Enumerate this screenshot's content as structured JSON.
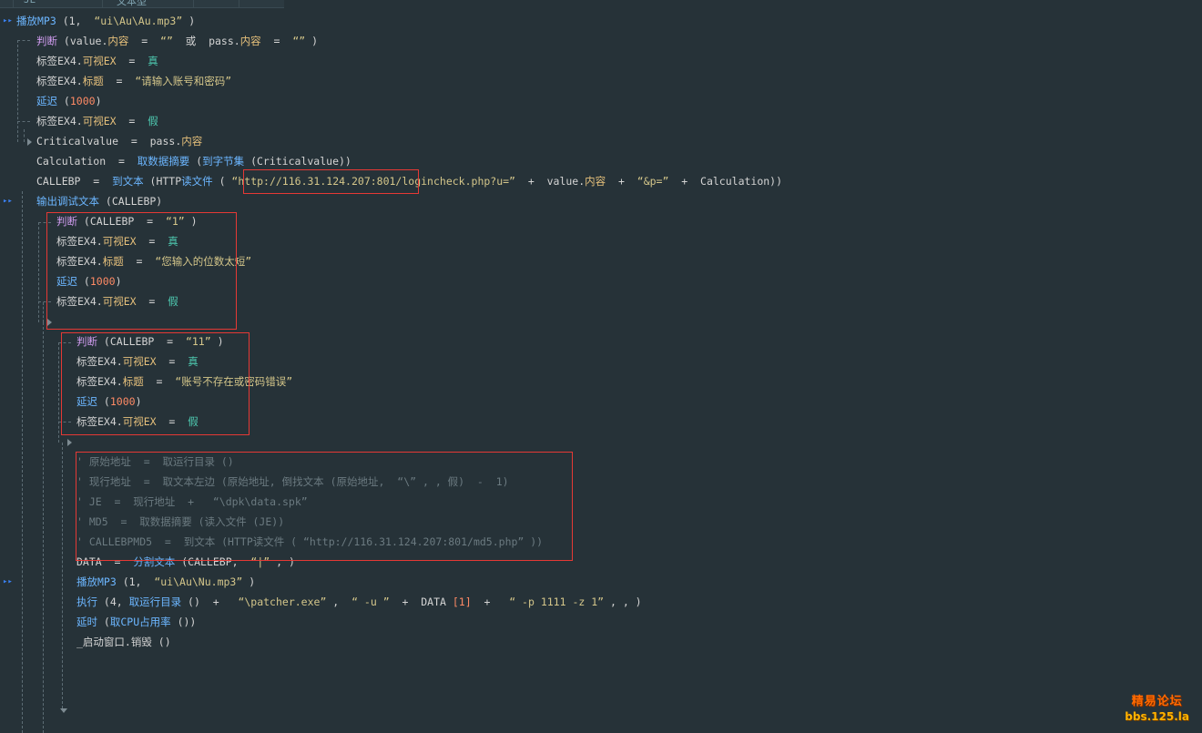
{
  "header": {
    "tab_left": "JE",
    "tab_right": "文本型"
  },
  "code": {
    "l1": {
      "fn": "播放MP3",
      "args": " (1,  ",
      "str": "“ui\\Au\\Au.mp3”",
      "tail": " )"
    },
    "l2": {
      "kw": "判断",
      "a": " (value.",
      "p1": "内容",
      "b": "  =  ",
      "s1": "“”",
      "c": "  或  pass.",
      "p2": "内容",
      "d": "  =  ",
      "s2": "“”",
      "e": " )"
    },
    "l3": {
      "a": "标签EX4.",
      "p": "可视EX",
      "b": "  =  ",
      "v": "真"
    },
    "l4": {
      "a": "标签EX4.",
      "p": "标题",
      "b": "  =  ",
      "s": "“请输入账号和密码”"
    },
    "l5": {
      "fn": "延迟",
      "a": " (",
      "n": "1000",
      "b": ")"
    },
    "l6": {
      "a": "标签EX4.",
      "p": "可视EX",
      "b": "  =  ",
      "v": "假"
    },
    "l7": {
      "a": "Criticalvalue  =  pass.",
      "p": "内容"
    },
    "l8": {
      "a": "Calculation  =  ",
      "fn1": "取数据摘要",
      "b": " (",
      "fn2": "到字节集",
      "c": " (Criticalvalue))"
    },
    "l9": {
      "a": "CALLEBP  =  ",
      "fn1": "到文本",
      "b": " (HTTP",
      "fn2": "读文件",
      "c": " ( ",
      "s1": "“http://116.31.124.207:801/logincheck.php?u=”",
      "d": "  +  value.",
      "p": "内容",
      "e": "  +  ",
      "s2": "“&p=”",
      "f": "  +  Calculation))"
    },
    "l10": {
      "fn": "输出调试文本",
      "a": " (CALLEBP)"
    },
    "l11": {
      "kw": "判断",
      "a": " (CALLEBP  =  ",
      "s": "“1”",
      "b": " )"
    },
    "l12": {
      "a": "标签EX4.",
      "p": "可视EX",
      "b": "  =  ",
      "v": "真"
    },
    "l13": {
      "a": "标签EX4.",
      "p": "标题",
      "b": "  =  ",
      "s": "“您输入的位数太短”"
    },
    "l14": {
      "fn": "延迟",
      "a": " (",
      "n": "1000",
      "b": ")"
    },
    "l15": {
      "a": "标签EX4.",
      "p": "可视EX",
      "b": "  =  ",
      "v": "假"
    },
    "l16": {
      "kw": "判断",
      "a": " (CALLEBP  =  ",
      "s": "“11”",
      "b": " )"
    },
    "l17": {
      "a": "标签EX4.",
      "p": "可视EX",
      "b": "  =  ",
      "v": "真"
    },
    "l18": {
      "a": "标签EX4.",
      "p": "标题",
      "b": "  =  ",
      "s": "“账号不存在或密码错误”"
    },
    "l19": {
      "fn": "延迟",
      "a": " (",
      "n": "1000",
      "b": ")"
    },
    "l20": {
      "a": "标签EX4.",
      "p": "可视EX",
      "b": "  =  ",
      "v": "假"
    },
    "c1": "' 原始地址  =  取运行目录 ()",
    "c2": "' 现行地址  =  取文本左边 (原始地址, 倒找文本 (原始地址,  “\\” , , 假)  -  1)",
    "c3": "' JE  =  现行地址  +   “\\dpk\\data.spk”",
    "c4": "' MD5  =  取数据摘要 (读入文件 (JE))",
    "c5": "' CALLEBPMD5  =  到文本 (HTTP读文件 ( “http://116.31.124.207:801/md5.php” ))",
    "l21": {
      "a": "DATA  =  ",
      "fn": "分割文本",
      "b": " (CALLEBP,  ",
      "s": "“|”",
      "c": " , )"
    },
    "l22": {
      "fn": "播放MP3",
      "a": " (1,  ",
      "s": "“ui\\Au\\Nu.mp3”",
      "b": " )"
    },
    "l23": {
      "fn1": "执行",
      "a": " (4, ",
      "fn2": "取运行目录",
      "b": " ()  +   ",
      "s1": "“\\patcher.exe”",
      "c": " ,  ",
      "s2": "“ -u ”",
      "d": "  +  DATA ",
      "n": "[1]",
      "e": "  +   ",
      "s3": "“ -p 1111 -z 1”",
      "f": " , , )"
    },
    "l24": {
      "fn1": "延时",
      "a": " (",
      "fn2": "取CPU占用率",
      "b": " ())"
    },
    "l25": {
      "a": "_启动窗口.销毁 ()"
    }
  },
  "watermark": {
    "line1": "精易论坛",
    "line2": "bbs.125.la"
  }
}
